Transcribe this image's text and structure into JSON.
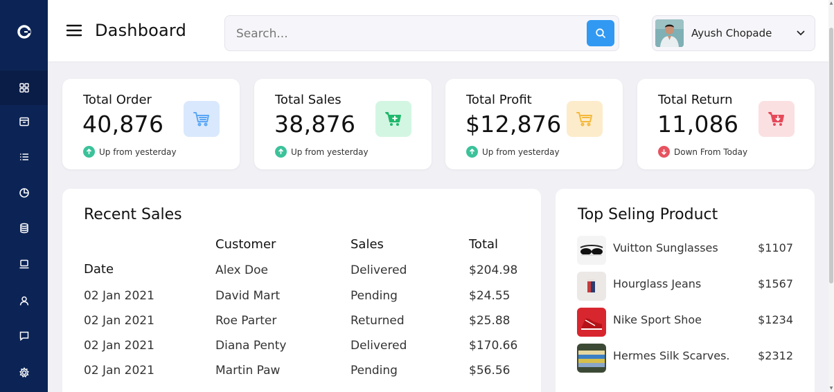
{
  "header": {
    "title": "Dashboard",
    "search_placeholder": "Search...",
    "user_name": "Ayush Chopade"
  },
  "sidebar": {
    "icons": [
      "logo-c-icon",
      "grid-icon",
      "archive-icon",
      "list-icon",
      "pie-chart-icon",
      "database-icon",
      "laptop-icon",
      "user-icon",
      "message-icon",
      "settings-icon"
    ]
  },
  "stats": [
    {
      "label": "Total Order",
      "value": "40,876",
      "trend": "Up from yesterday",
      "direction": "up",
      "icon_color": "#d9e8fd",
      "icon_fg": "#5aa6f5"
    },
    {
      "label": "Total Sales",
      "value": "38,876",
      "trend": "Up from yesterday",
      "direction": "up",
      "icon_color": "#d3f6e2",
      "icon_fg": "#1fb86c"
    },
    {
      "label": "Total Profit",
      "value": "$12,876",
      "trend": "Up from yesterday",
      "direction": "up",
      "icon_color": "#fdeccb",
      "icon_fg": "#f3b93a"
    },
    {
      "label": "Total Return",
      "value": "11,086",
      "trend": "Down From Today",
      "direction": "down",
      "icon_color": "#fbe0e2",
      "icon_fg": "#e64a5a"
    }
  ],
  "recent_sales": {
    "title": "Recent Sales",
    "columns": [
      "Date",
      "Customer",
      "Sales",
      "Total"
    ],
    "rows": [
      {
        "date": "",
        "customer": "Alex Doe",
        "sales": "Delivered",
        "total": "$204.98"
      },
      {
        "date": "02 Jan 2021",
        "customer": "David Mart",
        "sales": "Pending",
        "total": "$24.55"
      },
      {
        "date": "02 Jan 2021",
        "customer": "Roe Parter",
        "sales": "Returned",
        "total": "$25.88"
      },
      {
        "date": "02 Jan 2021",
        "customer": "Diana Penty",
        "sales": "Delivered",
        "total": "$170.66"
      },
      {
        "date": "02 Jan 2021",
        "customer": "Martin Paw",
        "sales": "Pending",
        "total": "$56.56"
      }
    ]
  },
  "top_selling": {
    "title": "Top Seling Product",
    "items": [
      {
        "name": "Vuitton Sunglasses",
        "price": "$1107"
      },
      {
        "name": "Hourglass Jeans",
        "price": "$1567"
      },
      {
        "name": "Nike Sport Shoe",
        "price": "$1234"
      },
      {
        "name": "Hermes Silk Scarves.",
        "price": "$2312"
      }
    ]
  },
  "colors": {
    "sidebar": "#0c2455",
    "accent": "#3199f2",
    "up": "#3cc29a",
    "down": "#e6535f"
  }
}
